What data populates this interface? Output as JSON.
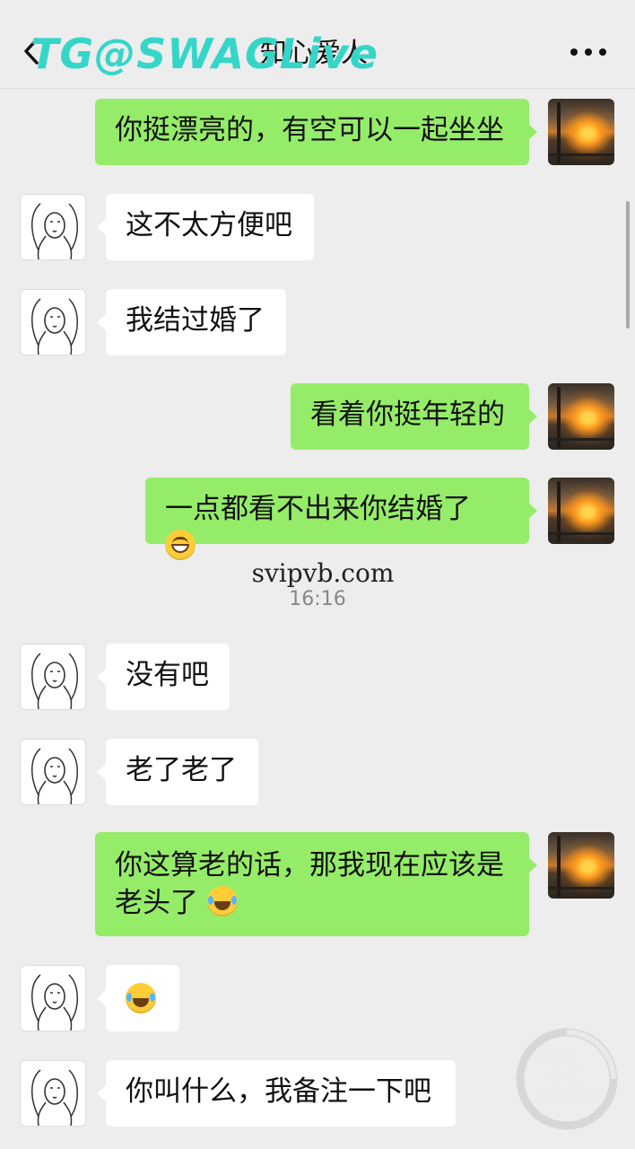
{
  "header": {
    "contact_name": "知心爱人",
    "watermark_text": "TG@SWAGLive",
    "back_icon": "chevron-left-icon",
    "more_icon": "more-dots-icon"
  },
  "messages": [
    {
      "side": "right",
      "text": "你挺漂亮的，有空可以一起坐坐"
    },
    {
      "side": "left",
      "text": "这不太方便吧"
    },
    {
      "side": "left",
      "text": "我结过婚了"
    },
    {
      "side": "right",
      "text": "看着你挺年轻的"
    },
    {
      "side": "right",
      "text": "一点都看不出来你结婚了",
      "emoji": "grin-emoji"
    },
    {
      "side": "left",
      "text": "没有吧"
    },
    {
      "side": "left",
      "text": "老了老了"
    },
    {
      "side": "right",
      "text_line1": "你这算老的话，那我现在应该是",
      "text_line2": "老头了",
      "emoji": "laugh-cry-emoji"
    },
    {
      "side": "left",
      "text": "",
      "emoji": "laugh-cry-emoji"
    },
    {
      "side": "left",
      "text": "你叫什么，我备注一下吧"
    }
  ],
  "center_watermark": "svipvb.com",
  "timestamp": "16:16",
  "colors": {
    "background": "#ededed",
    "outgoing_bubble": "#95ec69",
    "incoming_bubble": "#ffffff",
    "watermark": "#35d6c8"
  }
}
